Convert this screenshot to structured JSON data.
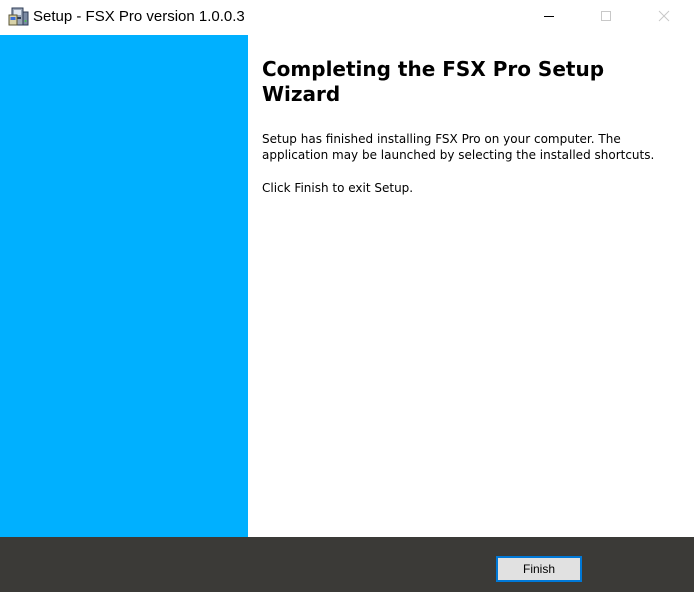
{
  "window": {
    "title": "Setup - FSX Pro version 1.0.0.3",
    "icon": "setup-installer-icon",
    "controls": [
      "minimize-icon",
      "maximize-icon",
      "close-icon"
    ]
  },
  "banner": {
    "color": "#00b0ff"
  },
  "content": {
    "heading": "Completing the FSX Pro Setup Wizard",
    "paragraph1": "Setup has finished installing FSX Pro on your computer. The application may be launched by selecting the installed shortcuts.",
    "paragraph2": "Click Finish to exit Setup."
  },
  "footer": {
    "finish_label": "Finish",
    "background": "#3b3a37",
    "focus_color": "#0078d7"
  }
}
